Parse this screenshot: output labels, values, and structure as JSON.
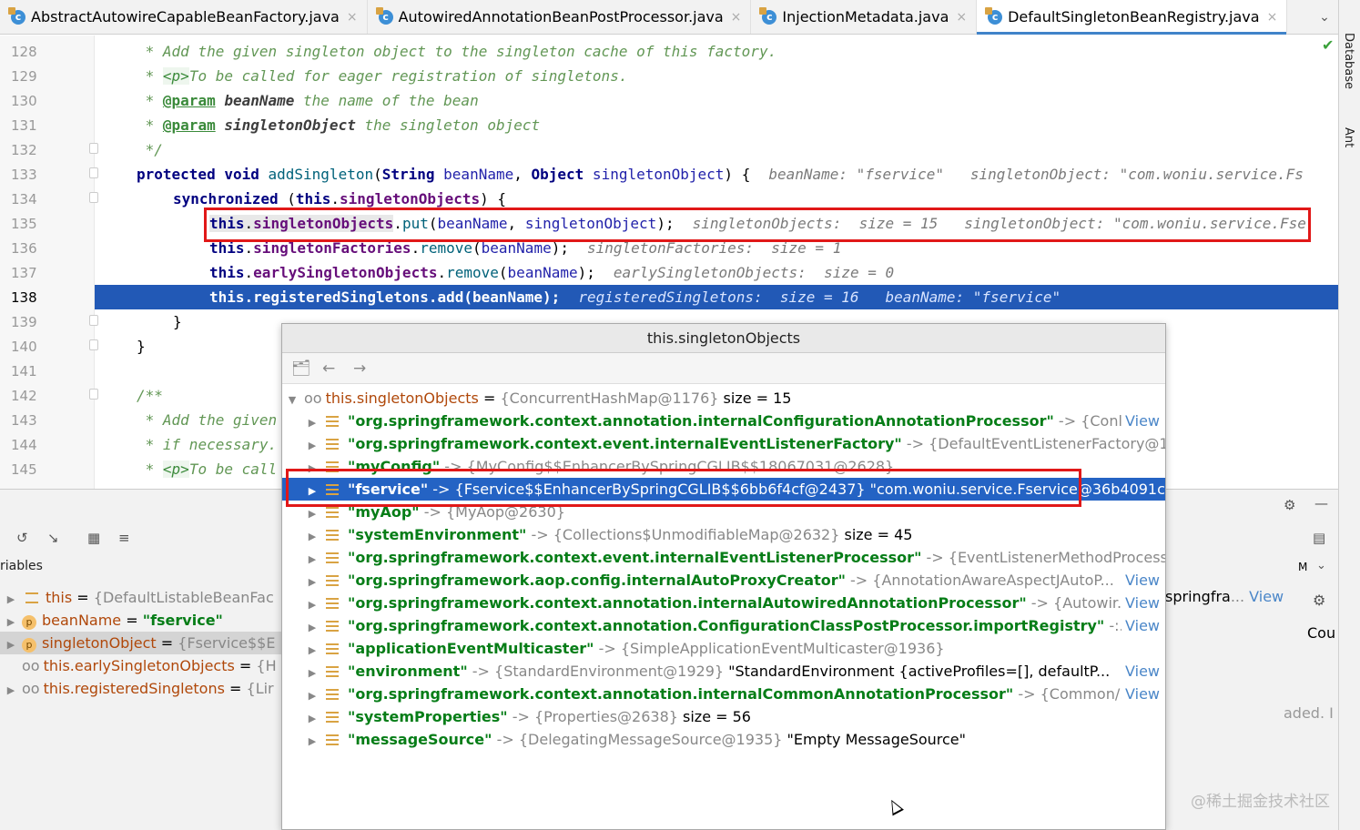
{
  "tabs": [
    {
      "label": "AbstractAutowireCapableBeanFactory.java",
      "icon": "c",
      "active": false
    },
    {
      "label": "AutowiredAnnotationBeanPostProcessor.java",
      "icon": "c",
      "active": false
    },
    {
      "label": "InjectionMetadata.java",
      "icon": "c",
      "active": false
    },
    {
      "label": "DefaultSingletonBeanRegistry.java",
      "icon": "c",
      "active": true
    }
  ],
  "tab_close_glyph": "×",
  "right_strip": {
    "database_label": "Database",
    "ant_label": "Ant"
  },
  "editor": {
    "line_numbers": [
      "128",
      "129",
      "130",
      "131",
      "132",
      "133",
      "134",
      "135",
      "136",
      "137",
      "138",
      "139",
      "140",
      "141",
      "142",
      "143",
      "144",
      "145"
    ],
    "lines": {
      "l128": {
        "star": " * ",
        "text": "Add the given singleton object to the singleton cache of this factory."
      },
      "l129": {
        "star": " * ",
        "html": "<p>",
        "text": "To be called for eager registration of singletons."
      },
      "l130": {
        "star": " * ",
        "tag": "@param",
        "param": " beanName",
        "text": " the name of the bean"
      },
      "l131": {
        "star": " * ",
        "tag": "@param",
        "param": " singletonObject",
        "text": " the singleton object"
      },
      "l132": {
        "text": " */"
      },
      "l133": {
        "kw1": "protected",
        "kw2": " void ",
        "fn": "addSingleton",
        "p1": "(",
        "t1": "String",
        "v1": " beanName",
        "c1": ", ",
        "t2": "Object",
        "v2": " singletonObject",
        "p2": ") {",
        "hint": "beanName: \"fservice\"   singletonObject: \"com.woniu.service.Fs"
      },
      "l134": {
        "kw": "synchronized",
        "open": " (",
        "this": "this",
        "dot": ".",
        "fld": "singletonObjects",
        "close": ") {"
      },
      "l135": {
        "this": "this",
        "dot": ".",
        "fld": "singletonObjects",
        "dot2": ".",
        "fn": "put",
        "a": "(",
        "v1": "beanName",
        "c": ", ",
        "v2": "singletonObject",
        "e": ");",
        "hint": "singletonObjects:  size = 15   singletonObject: \"com.woniu.service.Fse"
      },
      "l136": {
        "this": "this",
        "dot": ".",
        "fld": "singletonFactories",
        "dot2": ".",
        "fn": "remove",
        "a": "(",
        "v1": "beanName",
        "e": ");",
        "hint": "singletonFactories:  size = 1"
      },
      "l137": {
        "this": "this",
        "dot": ".",
        "fld": "earlySingletonObjects",
        "dot2": ".",
        "fn": "remove",
        "a": "(",
        "v1": "beanName",
        "e": ");",
        "hint": "earlySingletonObjects:  size = 0"
      },
      "l138": {
        "code": "this.registeredSingletons.add(beanName);",
        "hint": "registeredSingletons:  size = 16   beanName: \"fservice\""
      },
      "l139": {
        "text": "}"
      },
      "l140": {
        "text": "}"
      },
      "l142": {
        "text": "/**"
      },
      "l143": {
        "star": " * ",
        "text": "Add the given"
      },
      "l144": {
        "star": " * ",
        "text": "if necessary."
      },
      "l145": {
        "star": " * ",
        "html": "<p>",
        "text": "To be call"
      }
    }
  },
  "debugger": {
    "variables_label": "riables",
    "variables": [
      {
        "name": "this",
        "eq": " = ",
        "value": "{DefaultListableBeanFac",
        "kind": "field"
      },
      {
        "name": "beanName",
        "eq": " = ",
        "value": "\"fservice\"",
        "kind": "param",
        "string": true
      },
      {
        "name": "singletonObject",
        "eq": " = ",
        "value": "{Fservice$$E",
        "kind": "param"
      },
      {
        "name": "this.earlySingletonObjects",
        "eq": " = ",
        "value": "{H",
        "kind": "watch"
      },
      {
        "name": "this.registeredSingletons",
        "eq": " = ",
        "value": "{Lir",
        "kind": "watch"
      }
    ],
    "right_fragments": {
      "springfra": "springfra",
      "view": "View",
      "cou": "Cou",
      "aded": "aded. I",
      "m": "M"
    }
  },
  "popup": {
    "title": "this.singletonObjects",
    "root": {
      "name": "this.singletonObjects",
      "eq": " = ",
      "ref": "{ConcurrentHashMap@1176}",
      "size": "  size = 15"
    },
    "rows": [
      {
        "key": "\"org.springframework.context.annotation.internalConfigurationAnnotationProcessor\"",
        "arrow": " -> ",
        "ref": "{Conl...",
        "view": "View"
      },
      {
        "key": "\"org.springframework.context.event.internalEventListenerFactory\"",
        "arrow": " -> ",
        "ref": "{DefaultEventListenerFactory@1",
        "view": ""
      },
      {
        "key": "\"myConfig\"",
        "arrow": " -> ",
        "ref": "{MyConfig$$EnhancerBySpringCGLIB$$18067031@2628}",
        "view": ""
      },
      {
        "key": "\"fservice\"",
        "arrow": " -> ",
        "ref": "{Fservice$$EnhancerBySpringCGLIB$$6bb6f4cf@2437}",
        "extra": " \"com.woniu.service.Fservice@36b4091c",
        "view": "",
        "selected": true
      },
      {
        "key": "\"myAop\"",
        "arrow": " -> ",
        "ref": "{MyAop@2630}",
        "view": ""
      },
      {
        "key": "\"systemEnvironment\"",
        "arrow": " -> ",
        "ref": "{Collections$UnmodifiableMap@2632}",
        "extra": "  size = 45",
        "view": ""
      },
      {
        "key": "\"org.springframework.context.event.internalEventListenerProcessor\"",
        "arrow": " -> ",
        "ref": "{EventListenerMethodProcess",
        "view": ""
      },
      {
        "key": "\"org.springframework.aop.config.internalAutoProxyCreator\"",
        "arrow": " -> ",
        "ref": "{AnnotationAwareAspectJAutoP...",
        "view": "View"
      },
      {
        "key": "\"org.springframework.context.annotation.internalAutowiredAnnotationProcessor\"",
        "arrow": " -> ",
        "ref": "{Autowir...",
        "view": "View"
      },
      {
        "key": "\"org.springframework.context.annotation.ConfigurationClassPostProcessor.importRegistry\"",
        "arrow": " -:..",
        "ref": "",
        "view": "View"
      },
      {
        "key": "\"applicationEventMulticaster\"",
        "arrow": " -> ",
        "ref": "{SimpleApplicationEventMulticaster@1936}",
        "view": ""
      },
      {
        "key": "\"environment\"",
        "arrow": " -> ",
        "ref": "{StandardEnvironment@1929}",
        "extra": " \"StandardEnvironment {activeProfiles=[], defaultP...",
        "view": "View"
      },
      {
        "key": "\"org.springframework.context.annotation.internalCommonAnnotationProcessor\"",
        "arrow": " -> ",
        "ref": "{Common/...",
        "view": "View"
      },
      {
        "key": "\"systemProperties\"",
        "arrow": " -> ",
        "ref": "{Properties@2638}",
        "extra": "  size = 56",
        "view": ""
      },
      {
        "key": "\"messageSource\"",
        "arrow": " -> ",
        "ref": "{DelegatingMessageSource@1935}",
        "extra": " \"Empty MessageSource\"",
        "view": ""
      }
    ]
  },
  "watermark": "@稀土掘金技术社区",
  "colors": {
    "selection": "#2463c4",
    "current_line": "#2259b6",
    "highlight_box": "#e11818",
    "accent": "#4083c9"
  }
}
